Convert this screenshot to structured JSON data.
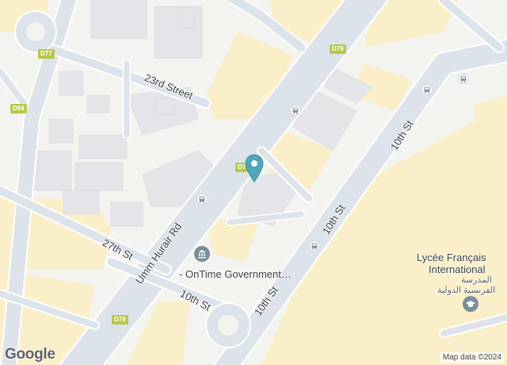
{
  "streets": {
    "street_23rd": "23rd Street",
    "street_27th": "27th St",
    "umm_hurair": "Umm Hurair Rd",
    "tenth_st_a": "10th St",
    "tenth_st_b": "10th St",
    "tenth_st_c": "10th St",
    "tenth_st_d": "10th St"
  },
  "route_badges": {
    "d77_top": "D77",
    "d78_top": "D78",
    "d84": "D84",
    "d78_center": "D78",
    "d78_bottom": "D78"
  },
  "places": {
    "ontime": "OnTime Government…",
    "lycee_line1": "Lycée Français",
    "lycee_line2": "International",
    "lycee_arabic1": "المدرسة",
    "lycee_arabic2": "الفرنسية الدولية"
  },
  "icons": {
    "bus_stop": "bus-icon",
    "government": "government-building-icon",
    "school": "school-icon",
    "pin": "location-pin-icon"
  },
  "colors": {
    "background": "#f3f3f0",
    "road": "#dde3ea",
    "road_edge": "#ffffff",
    "block": "#fbefc9",
    "building": "#e4e5e8",
    "pin": "#4fa7b7",
    "school_icon": "#7b8e9a"
  },
  "footer": {
    "logo": "Google",
    "attribution": "Map data ©2024"
  }
}
